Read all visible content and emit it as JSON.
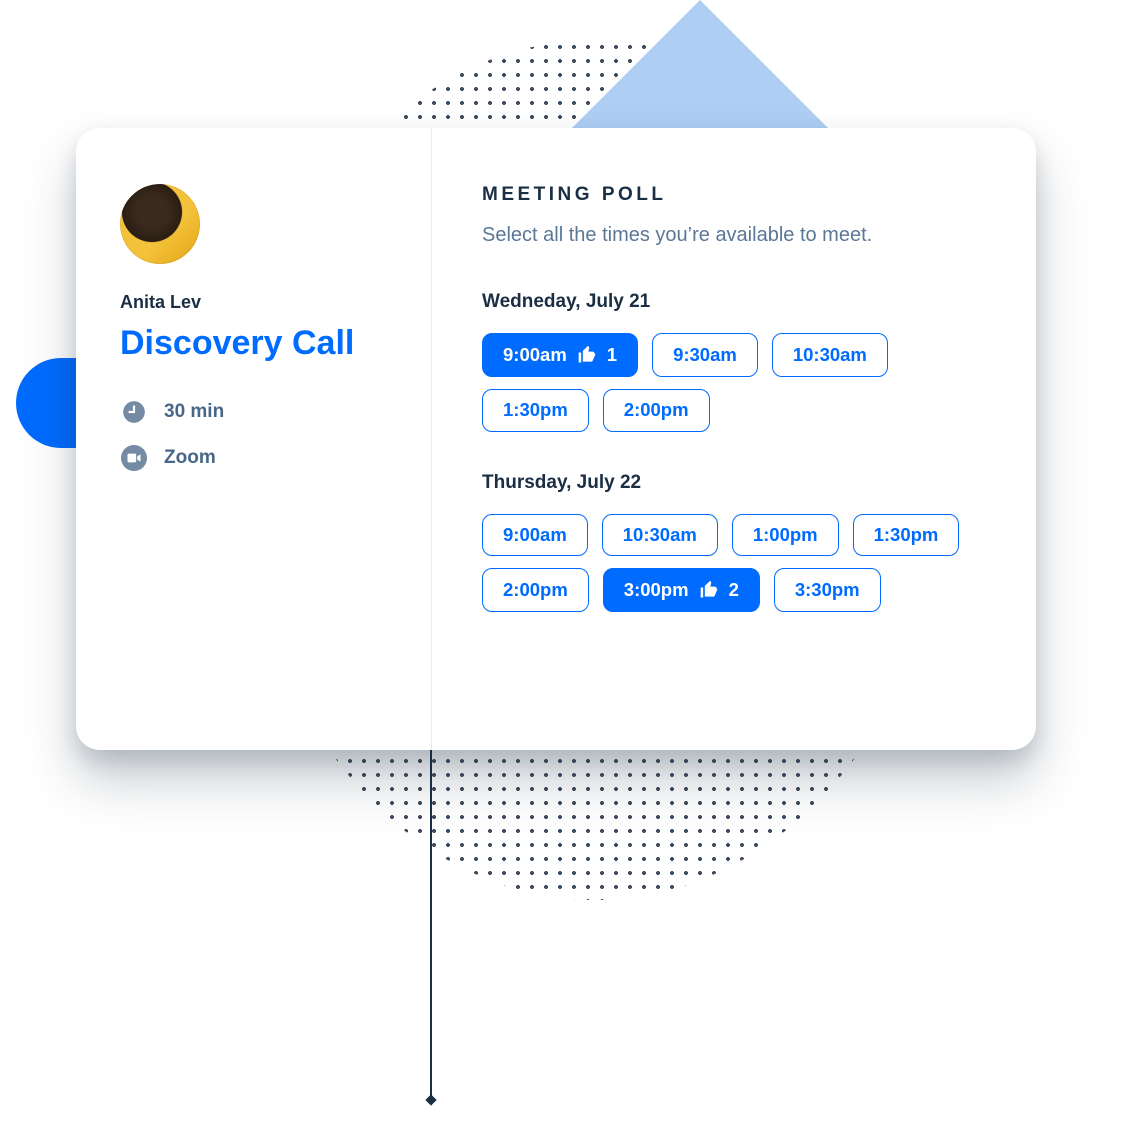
{
  "host": {
    "name": "Anita Lev"
  },
  "event": {
    "title": "Discovery Call",
    "duration_label": "30 min",
    "location_label": "Zoom"
  },
  "poll": {
    "title": "MEETING POLL",
    "subtitle": "Select all the times you’re available to meet.",
    "days": [
      {
        "label": "Wedneday, July 21",
        "slots": [
          {
            "time": "9:00am",
            "selected": true,
            "votes": 1
          },
          {
            "time": "9:30am",
            "selected": false
          },
          {
            "time": "10:30am",
            "selected": false
          },
          {
            "time": "1:30pm",
            "selected": false
          },
          {
            "time": "2:00pm",
            "selected": false
          }
        ]
      },
      {
        "label": "Thursday, July 22",
        "slots": [
          {
            "time": "9:00am",
            "selected": false
          },
          {
            "time": "10:30am",
            "selected": false
          },
          {
            "time": "1:00pm",
            "selected": false
          },
          {
            "time": "1:30pm",
            "selected": false
          },
          {
            "time": "2:00pm",
            "selected": false
          },
          {
            "time": "3:00pm",
            "selected": true,
            "votes": 2
          },
          {
            "time": "3:30pm",
            "selected": false
          }
        ]
      }
    ]
  },
  "colors": {
    "brand": "#006BFF",
    "text_primary": "#1A2E44",
    "text_muted": "#5B7796"
  }
}
